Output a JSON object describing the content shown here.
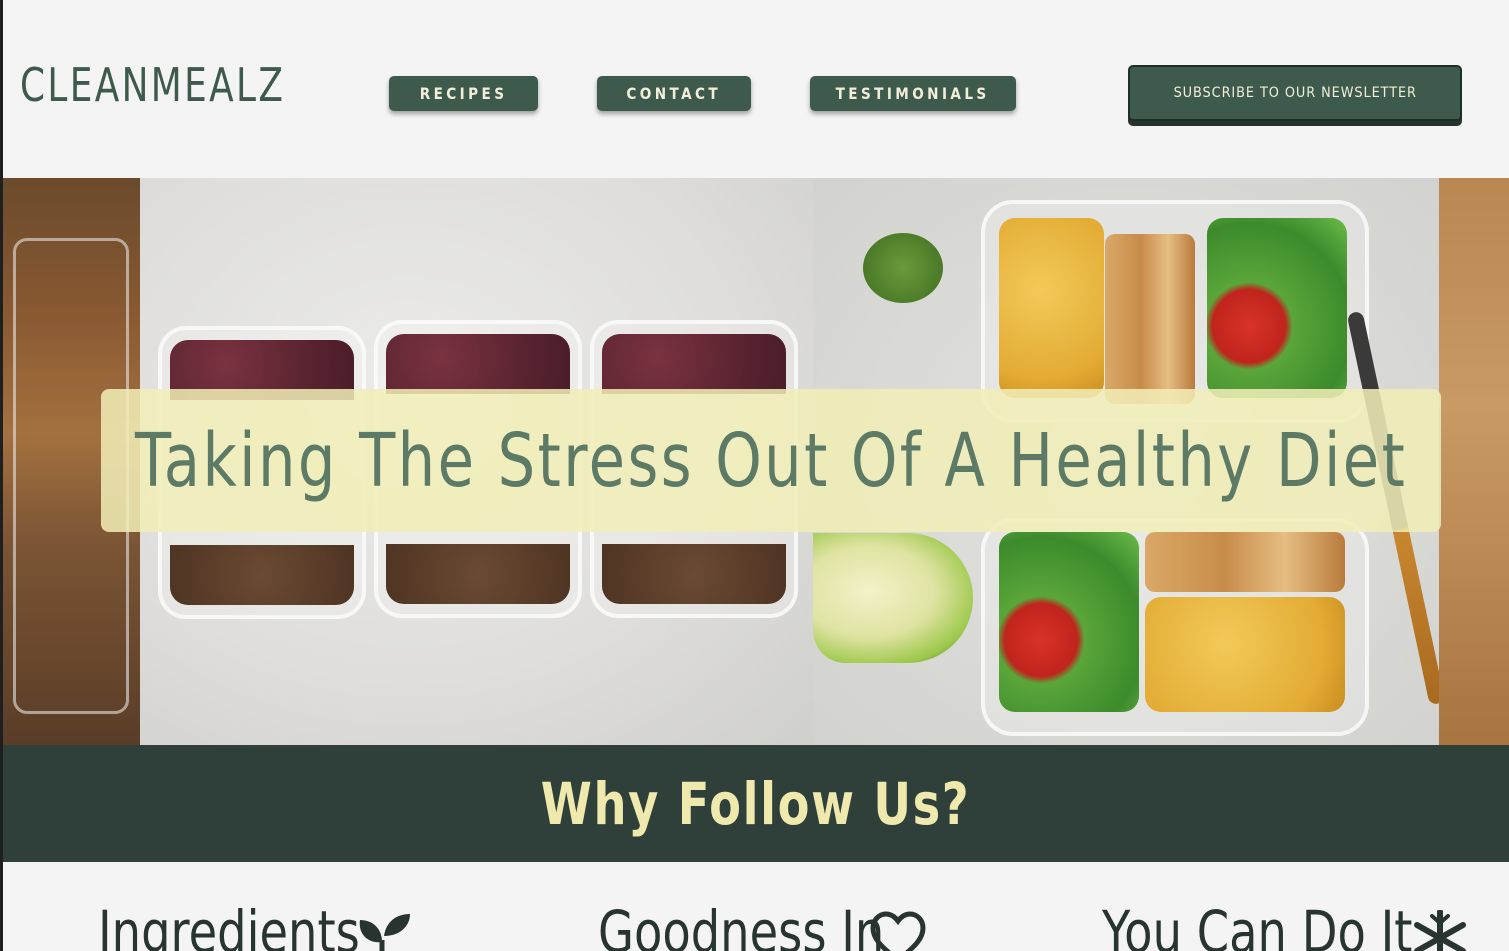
{
  "header": {
    "logo": "CLEANMEALZ",
    "nav": [
      {
        "label": "RECIPES"
      },
      {
        "label": "CONTACT"
      },
      {
        "label": "TESTIMONIALS"
      }
    ],
    "subscribe_label": "SUBSCRIBE TO OUR NEWSLETTER"
  },
  "hero": {
    "title": "Taking The Stress Out Of A Healthy Diet",
    "image": "meal-prep-containers-photo"
  },
  "why": {
    "title": "Why Follow Us?"
  },
  "features": [
    {
      "label": "Ingredients",
      "icon": "sprout-icon"
    },
    {
      "label": "Goodness In",
      "icon": "heart-icon"
    },
    {
      "label": "You Can Do It",
      "icon": "snowflake-icon"
    }
  ],
  "colors": {
    "primary_green": "#3d5a4d",
    "dark_band": "#2f3f3a",
    "cream": "#efe9ad",
    "banner_overlay": "#f1eeb7",
    "hero_text": "#5d7a66",
    "page_bg": "#f4f4f4"
  }
}
